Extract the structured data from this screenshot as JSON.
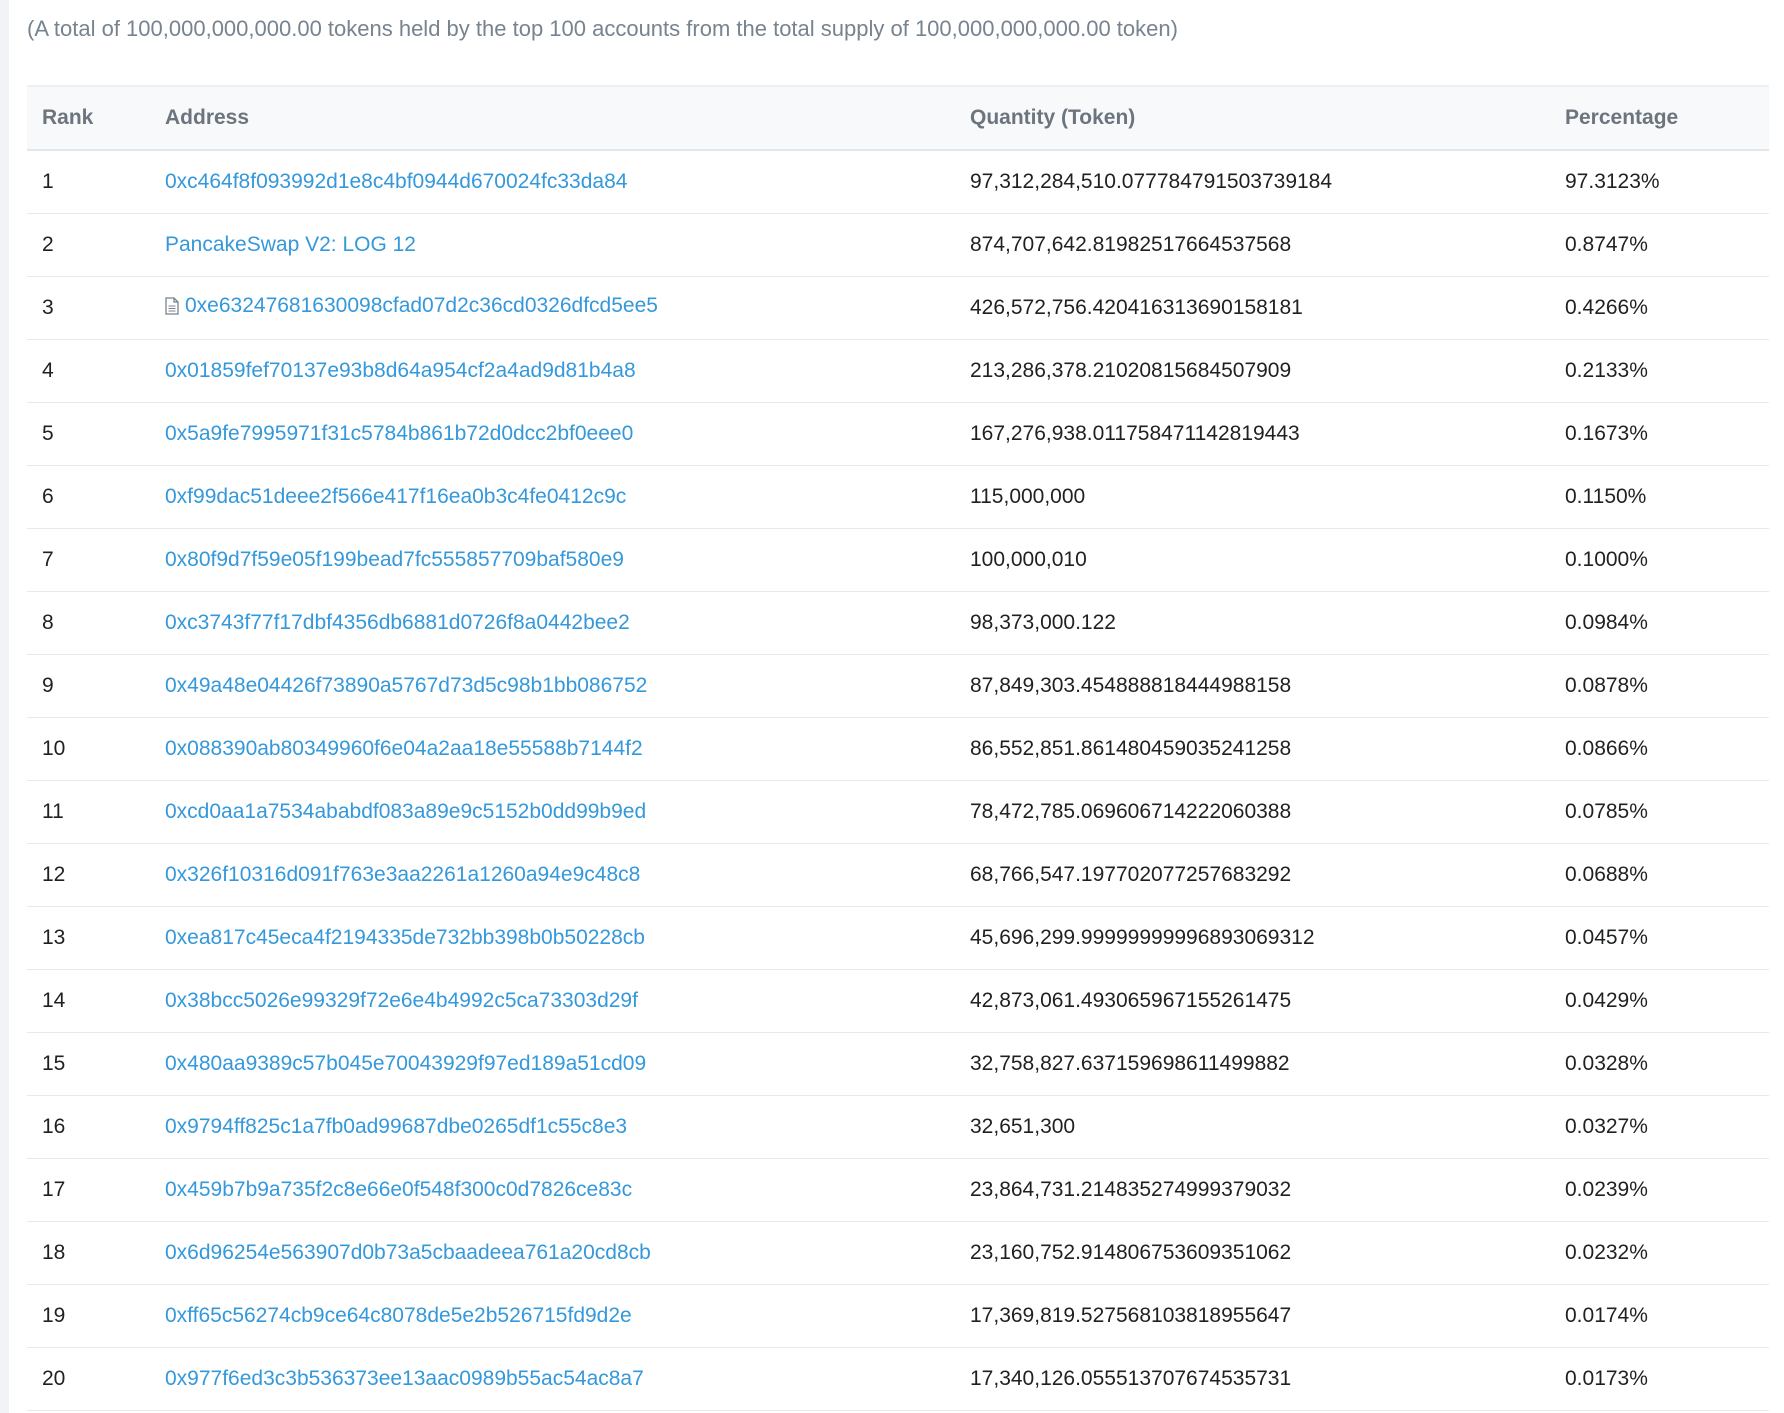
{
  "summary": "(A total of 100,000,000,000.00 tokens held by the top 100 accounts from the total supply of 100,000,000,000.00 token)",
  "colors": {
    "link": "#3498db",
    "header_text": "#6c757e",
    "summary_text": "#77838f",
    "row_border": "#e7eaf3"
  },
  "table": {
    "headers": {
      "rank": "Rank",
      "address": "Address",
      "quantity": "Quantity (Token)",
      "percentage": "Percentage"
    },
    "rows": [
      {
        "rank": "1",
        "address": "0xc464f8f093992d1e8c4bf0944d670024fc33da84",
        "contract": false,
        "quantity": "97,312,284,510.077784791503739184",
        "percentage": "97.3123%"
      },
      {
        "rank": "2",
        "address": "PancakeSwap V2: LOG 12",
        "contract": false,
        "quantity": "874,707,642.81982517664537568",
        "percentage": "0.8747%"
      },
      {
        "rank": "3",
        "address": "0xe63247681630098cfad07d2c36cd0326dfcd5ee5",
        "contract": true,
        "icon": "contract-file-icon",
        "quantity": "426,572,756.420416313690158181",
        "percentage": "0.4266%"
      },
      {
        "rank": "4",
        "address": "0x01859fef70137e93b8d64a954cf2a4ad9d81b4a8",
        "contract": false,
        "quantity": "213,286,378.21020815684507909",
        "percentage": "0.2133%"
      },
      {
        "rank": "5",
        "address": "0x5a9fe7995971f31c5784b861b72d0dcc2bf0eee0",
        "contract": false,
        "quantity": "167,276,938.011758471142819443",
        "percentage": "0.1673%"
      },
      {
        "rank": "6",
        "address": "0xf99dac51deee2f566e417f16ea0b3c4fe0412c9c",
        "contract": false,
        "quantity": "115,000,000",
        "percentage": "0.1150%"
      },
      {
        "rank": "7",
        "address": "0x80f9d7f59e05f199bead7fc555857709baf580e9",
        "contract": false,
        "quantity": "100,000,010",
        "percentage": "0.1000%"
      },
      {
        "rank": "8",
        "address": "0xc3743f77f17dbf4356db6881d0726f8a0442bee2",
        "contract": false,
        "quantity": "98,373,000.122",
        "percentage": "0.0984%"
      },
      {
        "rank": "9",
        "address": "0x49a48e04426f73890a5767d73d5c98b1bb086752",
        "contract": false,
        "quantity": "87,849,303.454888818444988158",
        "percentage": "0.0878%"
      },
      {
        "rank": "10",
        "address": "0x088390ab80349960f6e04a2aa18e55588b7144f2",
        "contract": false,
        "quantity": "86,552,851.861480459035241258",
        "percentage": "0.0866%"
      },
      {
        "rank": "11",
        "address": "0xcd0aa1a7534ababdf083a89e9c5152b0dd99b9ed",
        "contract": false,
        "quantity": "78,472,785.069606714222060388",
        "percentage": "0.0785%"
      },
      {
        "rank": "12",
        "address": "0x326f10316d091f763e3aa2261a1260a94e9c48c8",
        "contract": false,
        "quantity": "68,766,547.197702077257683292",
        "percentage": "0.0688%"
      },
      {
        "rank": "13",
        "address": "0xea817c45eca4f2194335de732bb398b0b50228cb",
        "contract": false,
        "quantity": "45,696,299.99999999996893069312",
        "percentage": "0.0457%"
      },
      {
        "rank": "14",
        "address": "0x38bcc5026e99329f72e6e4b4992c5ca73303d29f",
        "contract": false,
        "quantity": "42,873,061.493065967155261475",
        "percentage": "0.0429%"
      },
      {
        "rank": "15",
        "address": "0x480aa9389c57b045e70043929f97ed189a51cd09",
        "contract": false,
        "quantity": "32,758,827.637159698611499882",
        "percentage": "0.0328%"
      },
      {
        "rank": "16",
        "address": "0x9794ff825c1a7fb0ad99687dbe0265df1c55c8e3",
        "contract": false,
        "quantity": "32,651,300",
        "percentage": "0.0327%"
      },
      {
        "rank": "17",
        "address": "0x459b7b9a735f2c8e66e0f548f300c0d7826ce83c",
        "contract": false,
        "quantity": "23,864,731.214835274999379032",
        "percentage": "0.0239%"
      },
      {
        "rank": "18",
        "address": "0x6d96254e563907d0b73a5cbaadeea761a20cd8cb",
        "contract": false,
        "quantity": "23,160,752.914806753609351062",
        "percentage": "0.0232%"
      },
      {
        "rank": "19",
        "address": "0xff65c56274cb9ce64c8078de5e2b526715fd9d2e",
        "contract": false,
        "quantity": "17,369,819.527568103818955647",
        "percentage": "0.0174%"
      },
      {
        "rank": "20",
        "address": "0x977f6ed3c3b536373ee13aac0989b55ac54ac8a7",
        "contract": false,
        "quantity": "17,340,126.055513707674535731",
        "percentage": "0.0173%"
      }
    ]
  }
}
